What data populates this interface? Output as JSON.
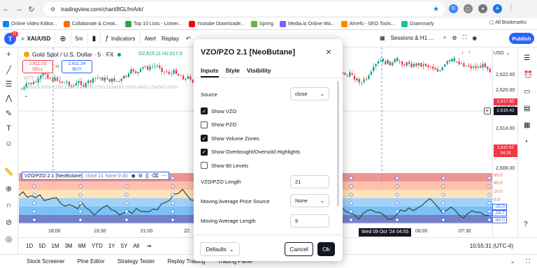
{
  "browser": {
    "url": "tradingview.com/chart/8GLfmArk/"
  },
  "bookmarks": [
    "Online Video Editor...",
    "Collaborate & Creat...",
    "Top 10 Lists - Listver...",
    "Youtube Downloade...",
    "Spring",
    "Media.io Online Wa...",
    "Ahrefs - SEO Tools...",
    "Grammarly"
  ],
  "all_bookmarks": "All Bookmarks",
  "toolbar": {
    "avatar": "T",
    "badge": "11",
    "symbol": "XAUUSD",
    "interval": "5m",
    "indicators": "Indicators",
    "alert": "Alert",
    "replay": "Replay",
    "session": "Sessions & H1 ...",
    "publish": "Publish"
  },
  "legend": {
    "title": "Gold Spot / U.S. Dollar · 5 · FX",
    "o": "O2,615.11",
    "h": "H2,617.0",
    "sell_price": "2,611.03",
    "sell": "SELL",
    "spread": "31",
    "buy_price": "2,611.34",
    "buy": "BUY",
    "line2": "WTF candle 5 14",
    "line3": "Session 0300-1200:1234567 0800-1700:1234567 2000-0400:1234567 0000-"
  },
  "indicator_legend": "VZO/PZO 2.1 [NeoButane]",
  "indicator_values": "close 21 None 9 40",
  "price_labels": [
    "2,622.00",
    "2,620.00",
    "2,618.00",
    "2,616.00",
    "2,614.00",
    "2,612.00",
    "2,608.00"
  ],
  "price_tags": {
    "red_upper": "2,617.85",
    "current": "2,616.42",
    "red_lower": "2,610.82",
    "red_lower_time": "04:29"
  },
  "currency": "USD",
  "osc_labels": [
    "60.0",
    "40.0",
    "20.0",
    "0.0",
    "-20.0",
    "-24.7",
    "-40.0"
  ],
  "time_labels": [
    "18:00",
    "19:30",
    "21:00",
    "22:",
    "06:00",
    "07:30"
  ],
  "crosshair_time": "Wed 09 Oct '24   04:55",
  "bottom": {
    "ranges": [
      "1D",
      "5D",
      "1M",
      "3M",
      "6M",
      "YTD",
      "1Y",
      "5Y",
      "All"
    ],
    "clock": "10:55:31 (UTC-4)"
  },
  "tabs": [
    "Stock Screener",
    "Pine Editor",
    "Strategy Tester",
    "Replay Trading",
    "Trading Panel"
  ],
  "dialog": {
    "title": "VZO/PZO 2.1 [NeoButane]",
    "tabs": [
      "Inputs",
      "Style",
      "Visibility"
    ],
    "source_label": "Source",
    "source_value": "close",
    "checks": [
      {
        "label": "Show VZO",
        "on": true
      },
      {
        "label": "Show PZO",
        "on": false
      },
      {
        "label": "Show Volume Zones",
        "on": true
      },
      {
        "label": "Show Overbought/Oversold Highlights",
        "on": true
      },
      {
        "label": "Show 80 Levels",
        "on": false
      }
    ],
    "length_label": "VZO/PZO Length",
    "length_value": "21",
    "ma_src_label": "Moving Average Price Source",
    "ma_src_value": "None",
    "ma_len_label": "Moving Average Length",
    "ma_len_value": "9",
    "defaults": "Defaults",
    "cancel": "Cancel",
    "ok": "Ok"
  },
  "colors": {
    "accent": "#2962ff",
    "up": "#089981",
    "down": "#f23645"
  }
}
